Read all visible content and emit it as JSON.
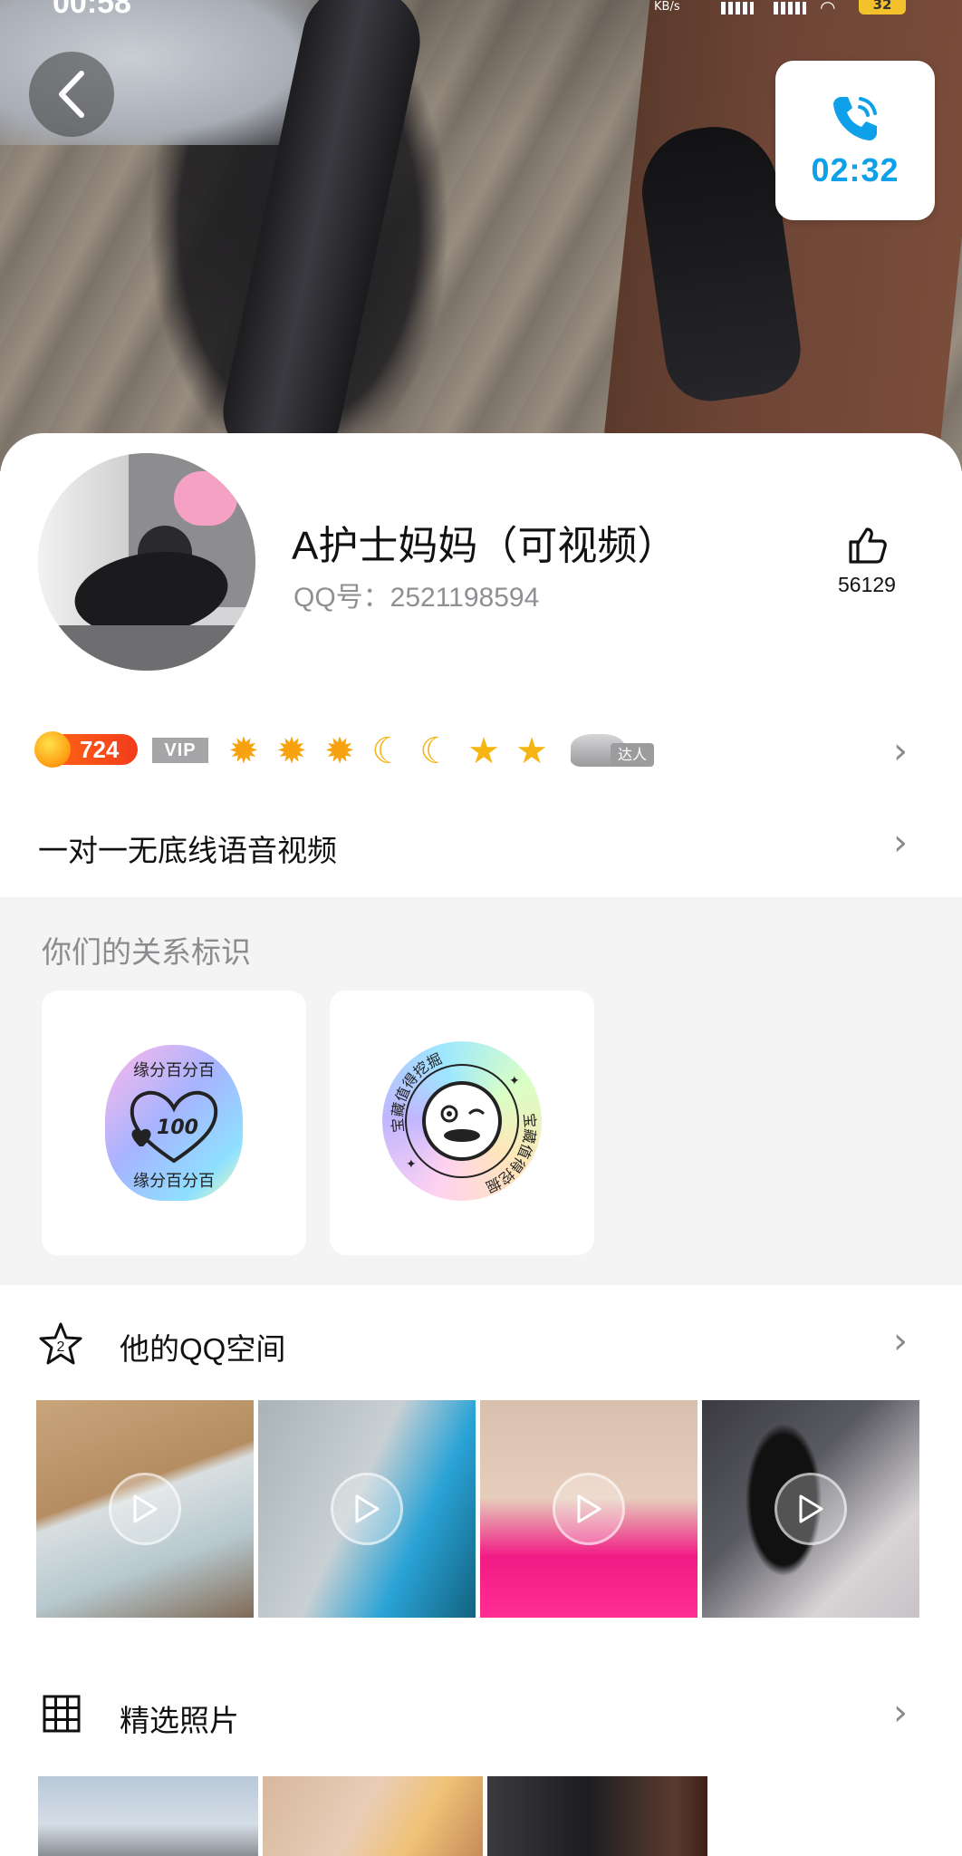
{
  "status_bar": {
    "time": "00:58",
    "net_speed": "KB/s",
    "battery": "32"
  },
  "call": {
    "duration": "02:32"
  },
  "profile": {
    "name": "A护士妈妈（可视频）",
    "qq_number": "QQ号：2521198594",
    "likes": "56129"
  },
  "badges": {
    "sun_level": "724",
    "vip_label": "VIP",
    "daren_label": "达人",
    "level_icons": [
      "sun",
      "sun",
      "sun",
      "moon",
      "moon",
      "star",
      "star"
    ]
  },
  "signature": "一对一无底线语音视频",
  "relationship": {
    "title": "你们的关系标识",
    "badges": [
      {
        "ring_text": "缘分百分百",
        "center_text": "100"
      },
      {
        "ring_text": "宝藏值得挖掘"
      }
    ]
  },
  "qzone": {
    "title": "他的QQ空间"
  },
  "photos": {
    "title": "精选照片"
  },
  "colors": {
    "accent_blue": "#0ea0e8",
    "sun_badge": "#f23c1c",
    "pink_skirt": "#f01b84"
  }
}
